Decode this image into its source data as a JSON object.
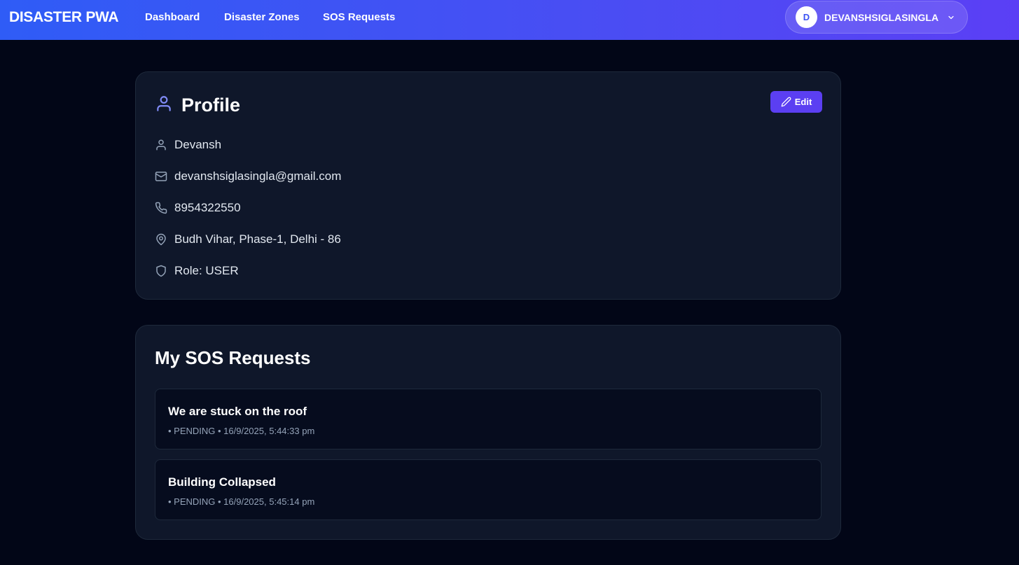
{
  "brand": "DISASTER PWA",
  "nav": [
    {
      "label": "Dashboard"
    },
    {
      "label": "Disaster Zones"
    },
    {
      "label": "SOS Requests"
    }
  ],
  "user": {
    "initial": "D",
    "name": "DEVANSHSIGLASINGLA"
  },
  "profile": {
    "title": "Profile",
    "edit_label": "Edit",
    "name": "Devansh",
    "email": "devanshsiglasingla@gmail.com",
    "phone": "8954322550",
    "address": "Budh Vihar, Phase-1, Delhi - 86",
    "role": "Role: USER"
  },
  "sos": {
    "title": "My SOS Requests",
    "items": [
      {
        "title": "We are stuck on the roof",
        "meta": "• PENDING • 16/9/2025, 5:44:33 pm"
      },
      {
        "title": "Building Collapsed",
        "meta": "• PENDING • 16/9/2025, 5:45:14 pm"
      }
    ]
  },
  "colors": {
    "background": "#020617",
    "card": "#0f172a",
    "accent": "#5b3ff2",
    "nav_gradient_start": "#2f5cf6",
    "nav_gradient_end": "#5b3ff5"
  },
  "icons": {
    "profile": "user-icon",
    "name": "user-icon",
    "email": "mail-icon",
    "phone": "phone-icon",
    "address": "map-pin-icon",
    "role": "shield-icon",
    "edit": "pencil-icon",
    "user_menu": "chevron-down-icon"
  }
}
